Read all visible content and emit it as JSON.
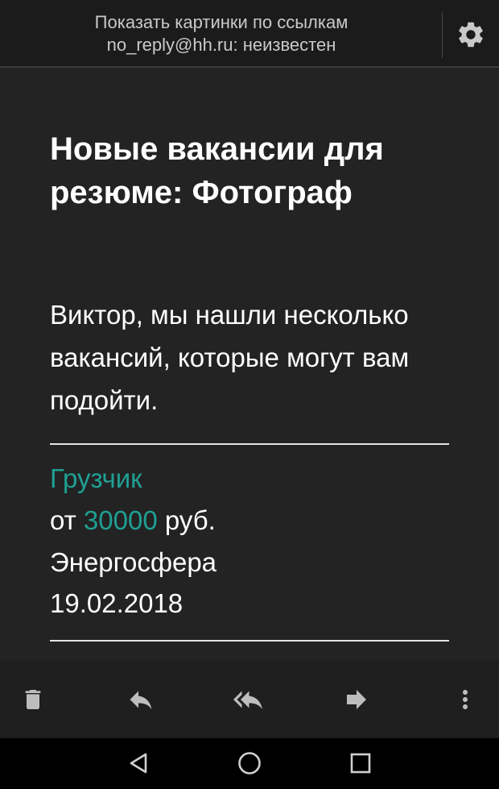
{
  "header": {
    "show_images_link": "Показать картинки по ссылкам",
    "sender_status": "no_reply@hh.ru: неизвестен",
    "settings_icon": "gear-icon"
  },
  "email": {
    "headline": "Новые вакансии для резюме: Фотограф",
    "intro": "Виктор, мы нашли несколько вакансий, которые могут вам подойти."
  },
  "vacancy": {
    "title": "Грузчик",
    "salary_prefix": "от",
    "salary_amount": "30000",
    "salary_suffix": "руб.",
    "company": "Энергосфера",
    "date": "19.02.2018"
  },
  "actions": [
    {
      "icon": "trash-icon"
    },
    {
      "icon": "reply-icon"
    },
    {
      "icon": "reply-all-icon"
    },
    {
      "icon": "forward-icon"
    },
    {
      "icon": "more-vert-icon"
    }
  ],
  "nav": [
    {
      "icon": "back-icon"
    },
    {
      "icon": "home-icon"
    },
    {
      "icon": "recents-icon"
    }
  ],
  "colors": {
    "accent": "#1fa093",
    "background": "#232323",
    "topbar": "#1b1b1b",
    "text": "#ffffff"
  }
}
